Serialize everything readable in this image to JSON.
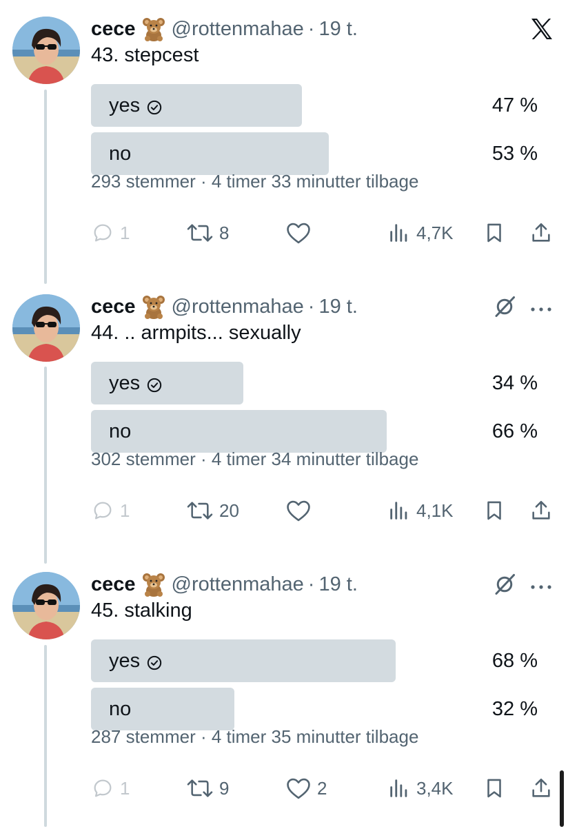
{
  "colors": {
    "accent": "#1d9bf0",
    "poll_bar": "#d3dbe0",
    "muted": "#536471",
    "thread_line": "#cfd9de"
  },
  "tweets": [
    {
      "name": "cece",
      "emoji_icon": "teddy-bear-icon",
      "handle": "@rottenmahae",
      "separator": "·",
      "time": "19 t.",
      "text": "43. stepcest",
      "top_icon": "x-logo-icon",
      "poll": [
        {
          "label": "yes",
          "percent_text": "47 %",
          "percent": 47,
          "selected": true
        },
        {
          "label": "no",
          "percent_text": "53 %",
          "percent": 53,
          "selected": false
        }
      ],
      "meta": "293 stemmer · 4 timer 33 minutter tilbage",
      "replies": "1",
      "retweets": "8",
      "likes": "",
      "views": "4,7K"
    },
    {
      "name": "cece",
      "emoji_icon": "teddy-bear-icon",
      "handle": "@rottenmahae",
      "separator": "·",
      "time": "19 t.",
      "text": "44. .. armpits... sexually",
      "top_icon": "grok-icon",
      "poll": [
        {
          "label": "yes",
          "percent_text": "34 %",
          "percent": 34,
          "selected": true
        },
        {
          "label": "no",
          "percent_text": "66 %",
          "percent": 66,
          "selected": false
        }
      ],
      "meta": "302 stemmer · 4 timer 34 minutter tilbage",
      "replies": "1",
      "retweets": "20",
      "likes": "",
      "views": "4,1K"
    },
    {
      "name": "cece",
      "emoji_icon": "teddy-bear-icon",
      "handle": "@rottenmahae",
      "separator": "·",
      "time": "19 t.",
      "text": "45. stalking",
      "top_icon": "grok-icon",
      "poll": [
        {
          "label": "yes",
          "percent_text": "68 %",
          "percent": 68,
          "selected": true
        },
        {
          "label": "no",
          "percent_text": "32 %",
          "percent": 32,
          "selected": false
        }
      ],
      "meta": "287 stemmer · 4 timer 35 minutter tilbage",
      "replies": "1",
      "retweets": "9",
      "likes": "2",
      "views": "3,4K"
    }
  ]
}
